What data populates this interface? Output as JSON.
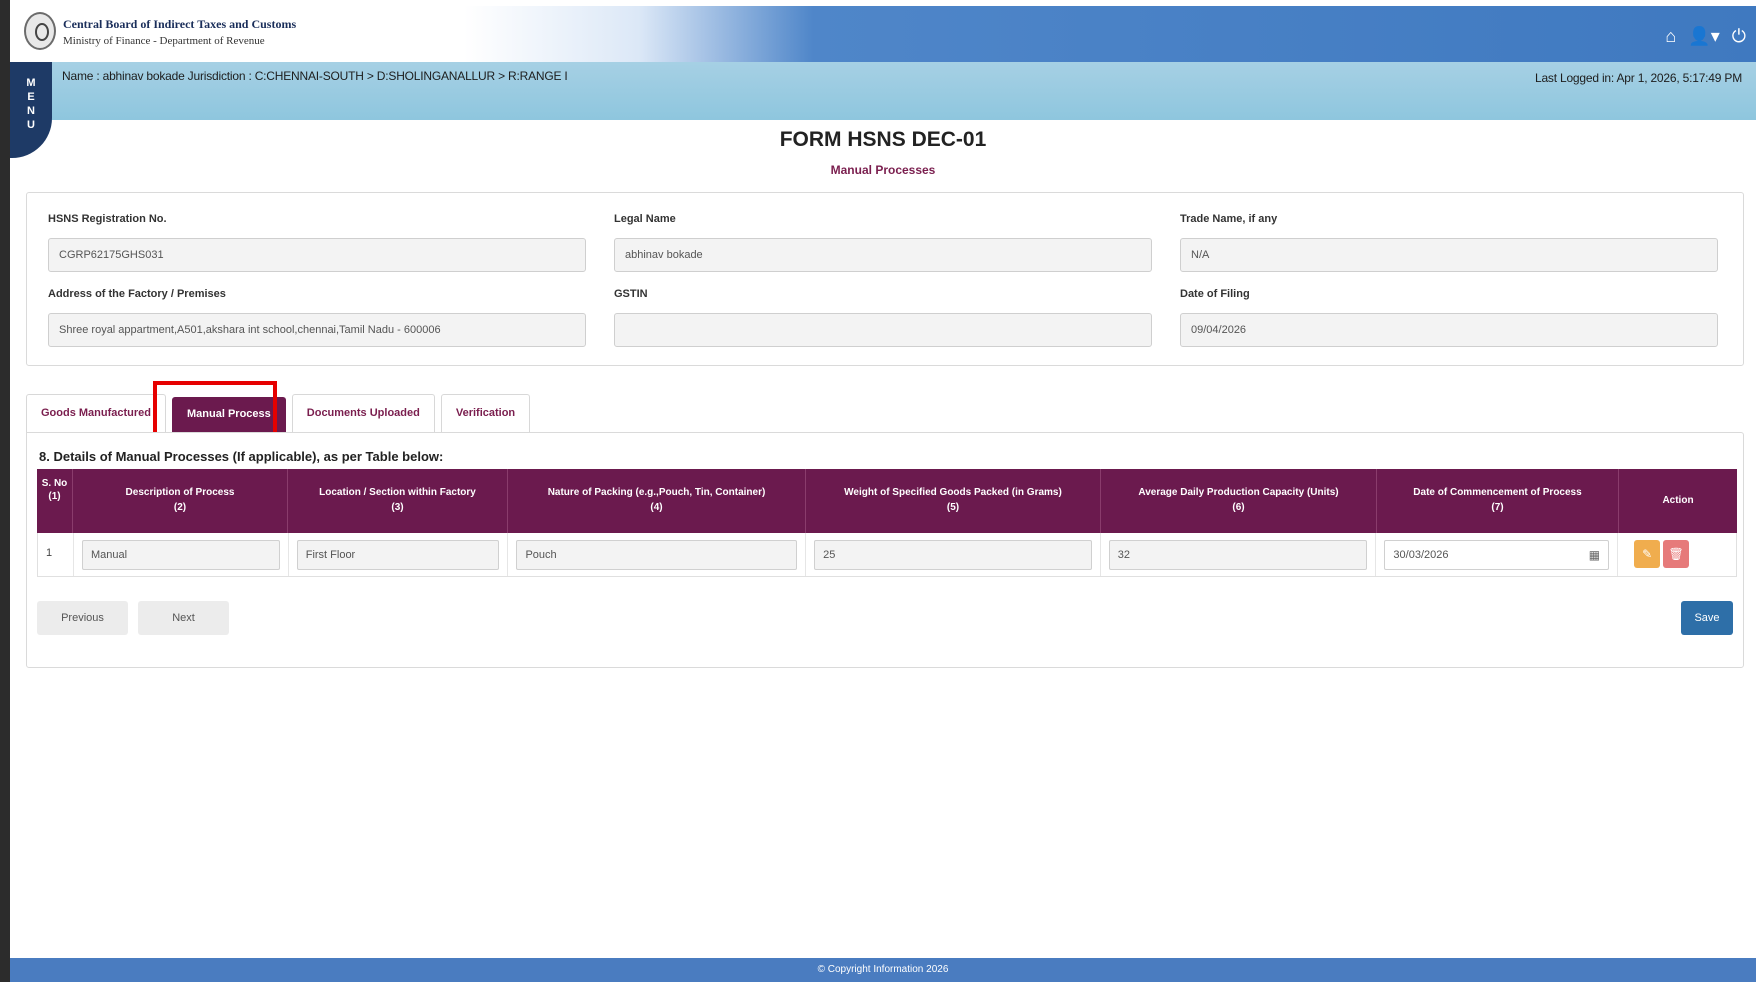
{
  "header": {
    "org_name": "Central Board of Indirect Taxes and Customs",
    "org_sub": "Ministry of Finance - Department of Revenue",
    "icons": [
      "home-icon",
      "user-icon",
      "power-icon"
    ]
  },
  "infobar": {
    "user_line": "Name : abhinav bokade    Jurisdiction : C:CHENNAI-SOUTH > D:SHOLINGANALLUR > R:RANGE I",
    "last_logged": "Last Logged in: Apr 1, 2026, 5:17:49 PM"
  },
  "menu": {
    "label": "MENU"
  },
  "form": {
    "title": "FORM HSNS DEC-01",
    "subtitle": "Manual Processes"
  },
  "fields": {
    "reg_no": {
      "label": "HSNS Registration No.",
      "value": "CGRP62175GHS031"
    },
    "legal_name": {
      "label": "Legal Name",
      "value": "abhinav bokade"
    },
    "trade_name": {
      "label": "Trade Name, if any",
      "value": "N/A"
    },
    "address": {
      "label": "Address of the Factory / Premises",
      "value": "Shree royal appartment,A501,akshara int school,chennai,Tamil Nadu - 600006"
    },
    "gstin": {
      "label": "GSTIN",
      "value": ""
    },
    "date_filing": {
      "label": "Date of Filing",
      "value": "09/04/2026"
    }
  },
  "tabs": [
    {
      "label": "Goods Manufactured"
    },
    {
      "label": "Manual Process"
    },
    {
      "label": "Documents Uploaded"
    },
    {
      "label": "Verification"
    }
  ],
  "section": {
    "title": "8. Details of Manual Processes (If applicable), as per Table below:"
  },
  "table": {
    "headers": [
      {
        "label": "S. No",
        "num": "(1)"
      },
      {
        "label": "Description of Process",
        "num": "(2)"
      },
      {
        "label": "Location / Section within Factory",
        "num": "(3)"
      },
      {
        "label": "Nature of Packing (e.g.,Pouch, Tin, Container)",
        "num": "(4)"
      },
      {
        "label": "Weight of Specified Goods Packed (in Grams)",
        "num": "(5)"
      },
      {
        "label": "Average Daily Production Capacity (Units)",
        "num": "(6)"
      },
      {
        "label": "Date of Commencement of Process",
        "num": "(7)"
      },
      {
        "label": "Action",
        "num": ""
      }
    ],
    "rows": [
      {
        "sno": "1",
        "description": "Manual",
        "location": "First Floor",
        "packing": "Pouch",
        "weight": "25",
        "capacity": "32",
        "date": "30/03/2026"
      }
    ]
  },
  "buttons": {
    "previous": "Previous",
    "next": "Next",
    "save": "Save"
  },
  "footer": {
    "copyright": "© Copyright Information 2026"
  },
  "colors": {
    "header_blue": "#3f79c0",
    "tab_active": "#6b1a4e",
    "save_button": "#2e6fa8",
    "highlight": "#e60000"
  }
}
